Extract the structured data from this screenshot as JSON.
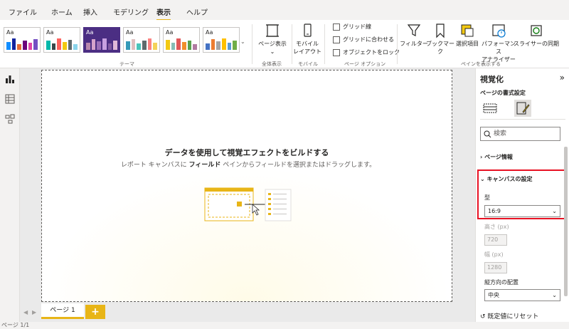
{
  "tabs": [
    "ファイル",
    "ホーム",
    "挿入",
    "モデリング",
    "表示",
    "ヘルプ"
  ],
  "active_tab": "表示",
  "ribbon": {
    "themes_label": "テーマ",
    "theme_sample_text": "Aa",
    "page_view_label": "ページ表示",
    "page_view_group": "全体表示",
    "mobile_label_1": "モバイル",
    "mobile_label_2": "レイアウト",
    "mobile_group": "モバイル",
    "gridlines": "グリッド線",
    "snap_to_grid": "グリッドに合わせる",
    "lock_objects": "オブジェクトをロック",
    "page_options_group": "ページ オプション",
    "filter": "フィルター",
    "bookmark": "ブックマーク",
    "selection_1": "選択項目",
    "performance_1": "パフォーマンス",
    "performance_2": "アナライザー",
    "sync_slicers": "スライサーの同期",
    "show_panes_group": "ペインを表示する"
  },
  "canvas": {
    "title": "データを使用して視覚エフェクトをビルドする",
    "desc_before": "レポート キャンバスに ",
    "desc_bold": "フィールド",
    "desc_after": " ペインからフィールドを選択またはドラッグします。"
  },
  "pages": {
    "tab_label": "ページ 1",
    "add_label": "+",
    "status": "ページ 1/1"
  },
  "pane": {
    "title": "視覚化",
    "collapse": "»",
    "subtitle": "ページの書式設定",
    "search_placeholder": "検索",
    "page_info": "ページ情報",
    "canvas_settings": "キャンバスの設定",
    "type_label": "型",
    "type_value": "16:9",
    "height_label": "高さ (px)",
    "height_value": "720",
    "width_label": "幅 (px)",
    "width_value": "1280",
    "vertical_label": "縦方向の配置",
    "vertical_value": "中央",
    "reset": "既定値にリセット"
  }
}
